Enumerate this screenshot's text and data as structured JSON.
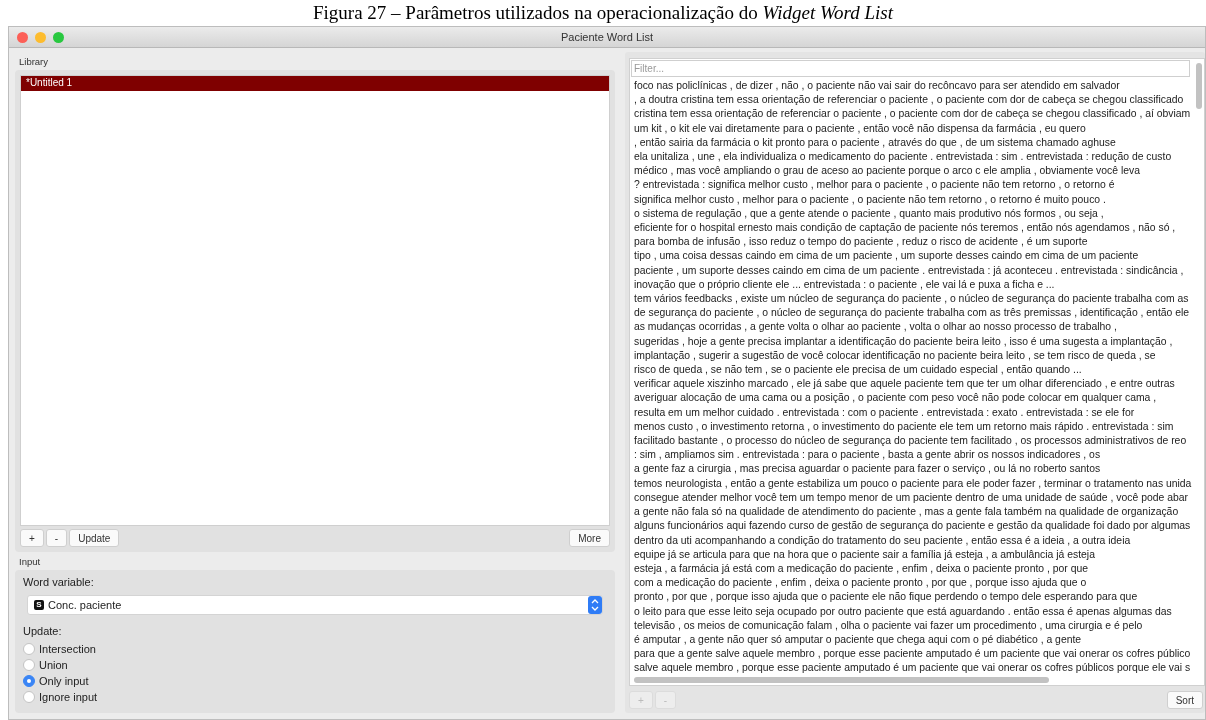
{
  "caption": "Figura 27 – Parâmetros utilizados na operacionalização do *Widget Word List*",
  "window": {
    "title": "Paciente Word List"
  },
  "library": {
    "label": "Library",
    "items": [
      {
        "name": "*Untitled 1",
        "selected": true
      }
    ],
    "buttons": [
      {
        "label": "+",
        "disabled": false
      },
      {
        "label": "-",
        "disabled": false
      },
      {
        "label": "Update",
        "disabled": false
      }
    ],
    "more_button": "More"
  },
  "input": {
    "label": "Input",
    "word_variable": {
      "label": "Word variable:",
      "type_badge": "S",
      "value": "Conc. paciente"
    },
    "update": {
      "label": "Update:",
      "options": [
        {
          "label": "Intersection",
          "selected": false
        },
        {
          "label": "Union",
          "selected": false
        },
        {
          "label": "Only input",
          "selected": true
        },
        {
          "label": "Ignore input",
          "selected": false
        }
      ]
    }
  },
  "words": {
    "filter": {
      "placeholder": "Filter..."
    },
    "items": [
      "foco nas policlínicas , de dizer , não , o paciente não vai sair do recôncavo para ser atendido em salvador",
      ", a doutra cristina tem essa orientação de referenciar o paciente , o paciente com dor de cabeça se chegou classificado",
      "cristina tem essa orientação de referenciar o paciente , o paciente com dor de cabeça se chegou classificado , aí obviam",
      "um kit , o kit ele vai diretamente para o paciente , então você não dispensa da farmácia , eu quero",
      ", então sairia da farmácia o kit pronto para o paciente , através do que , de um sistema chamado aghuse",
      "ela unitaliza , une , ela individualiza o medicamento do paciente . entrevistada : sim . entrevistada : redução de custo",
      "médico , mas você ampliando o grau de aceso ao paciente porque o arco c ele amplia , obviamente você leva",
      "? entrevistada : significa melhor custo , melhor para o paciente , o paciente não tem retorno , o retorno é",
      "significa melhor custo , melhor para o paciente , o paciente não tem retorno , o retorno é muito pouco .",
      "o sistema de regulação , que a gente atende o paciente , quanto mais produtivo nós formos , ou seja ,",
      "eficiente for o hospital ernesto mais condição de captação de paciente nós teremos , então nós agendamos , não só ,",
      "para bomba de infusão , isso reduz o tempo do paciente , reduz o risco de acidente , é um suporte",
      "tipo , uma coisa dessas caindo em cima de um paciente , um suporte desses caindo em cima de um paciente",
      "paciente , um suporte desses caindo em cima de um paciente . entrevistada : já aconteceu . entrevistada : sindicância ,",
      "inovação que o próprio cliente ele ... entrevistada : o paciente , ele vai lá e puxa a ficha e ...",
      "tem vários feedbacks , existe um núcleo de segurança do paciente , o núcleo de segurança do paciente trabalha com as",
      "de segurança do paciente , o núcleo de segurança do paciente trabalha com as três premissas , identificação , então ele",
      "as mudanças ocorridas , a gente volta o olhar ao paciente , volta o olhar ao nosso processo de trabalho ,",
      "sugeridas , hoje a gente precisa implantar a identificação do paciente beira leito , isso é uma sugesta a implantação ,",
      "implantação , sugerir a sugestão de você colocar identificação no paciente beira leito , se tem risco de queda , se",
      "risco de queda , se não tem , se o paciente ele precisa de um cuidado especial , então quando ...",
      "verificar aquele xiszinho marcado , ele já sabe que aquele paciente tem que ter um olhar diferenciado , e entre outras",
      "averiguar alocação de uma cama ou a posição , o paciente com peso você não pode colocar em qualquer cama ,",
      "resulta em um melhor cuidado . entrevistada : com o paciente . entrevistada : exato . entrevistada : se ele for",
      "menos custo , o investimento retorna , o investimento do paciente ele tem um retorno mais rápido . entrevistada : sim",
      "facilitado bastante , o processo do núcleo de segurança do paciente tem facilitado , os processos administrativos de reo",
      ": sim , ampliamos sim . entrevistada : para o paciente , basta a gente abrir os nossos indicadores , os",
      "a gente faz a cirurgia , mas precisa aguardar o paciente para fazer o serviço , ou lá no roberto santos",
      "temos neurologista , então a gente estabiliza um pouco o paciente para ele poder fazer , terminar o tratamento nas unida",
      "consegue atender melhor você tem um tempo menor de um paciente dentro de uma unidade de saúde , você pode abar",
      "a gente não fala só na qualidade de atendimento do paciente , mas a gente fala também na qualidade de organização",
      "alguns funcionários aqui fazendo curso de gestão de segurança do paciente e gestão da qualidade foi dado por algumas",
      "dentro da uti acompanhando a condição do tratamento do seu paciente , então essa é a ideia , a outra ideia",
      "equipe já se articula para que na hora que o paciente sair a família já esteja , a ambulância já esteja",
      "esteja , a farmácia já está com a medicação do paciente , enfim , deixa o paciente pronto , por que",
      "com a medicação do paciente , enfim , deixa o paciente pronto , por que , porque isso ajuda que o",
      "pronto , por que , porque isso ajuda que o paciente ele não fique perdendo o tempo dele esperando para que",
      "o leito para que esse leito seja ocupado por outro paciente que está aguardando . então essa é apenas algumas das",
      "televisão , os meios de comunicação falam , olha o paciente vai fazer um procedimento , uma cirurgia e é pelo",
      "é amputar , a gente não quer só amputar o paciente que chega aqui com o pé diabético , a gente",
      "para que a gente salve aquele membro , porque esse paciente amputado é um paciente que vai onerar os cofres público",
      "salve aquele membro , porque esse paciente amputado é um paciente que vai onerar os cofres públicos porque ele vai s"
    ],
    "buttons": [
      {
        "label": "+",
        "disabled": true
      },
      {
        "label": "-",
        "disabled": true
      }
    ],
    "sort_button": "Sort"
  }
}
